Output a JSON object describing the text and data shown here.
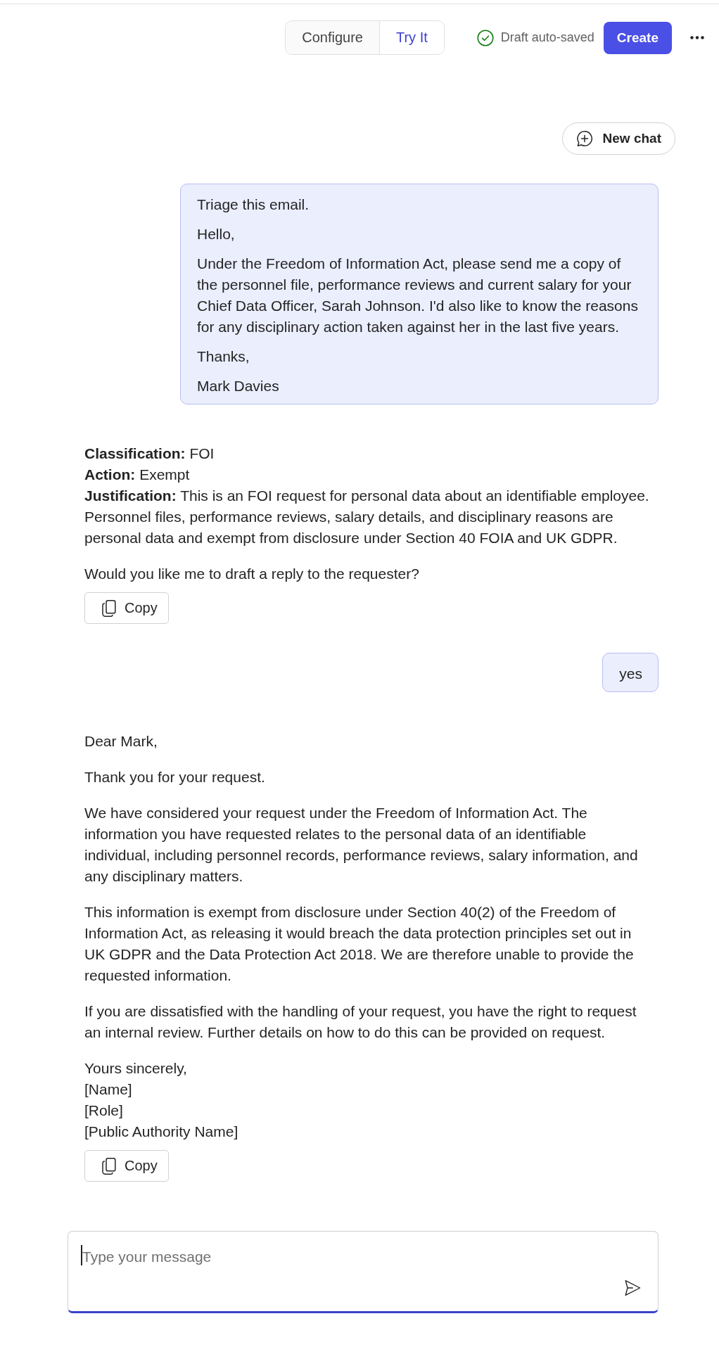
{
  "header": {
    "tabs": [
      {
        "label": "Configure",
        "selected": false
      },
      {
        "label": "Try It",
        "selected": true
      }
    ],
    "save_status": "Draft auto-saved",
    "create_button": "Create"
  },
  "new_chat_button": "New chat",
  "messages": [
    {
      "kind": "user",
      "paragraphs": [
        "Triage this email.",
        "Hello,",
        "Under the Freedom of Information Act, please send me a copy of the personnel file, performance reviews and current salary for your Chief Data Officer, Sarah Johnson. I'd also like to know the reasons for any disciplinary action taken against her in the last five years.",
        "Thanks,",
        "Mark Davies"
      ]
    },
    {
      "kind": "assistant",
      "blocks": [
        {
          "kind": "lines",
          "lines": [
            "**Classification:** FOI",
            "**Action:** Exempt",
            "**Justification:** This is an FOI request for personal data about an identifiable employee. Personnel files, performance reviews, salary details, and disciplinary reasons are personal data and exempt from disclosure under Section 40 FOIA and UK GDPR."
          ]
        },
        {
          "kind": "paragraph",
          "text": "Would you like me to draft a reply to the requester?"
        }
      ],
      "copy_button": "Copy"
    },
    {
      "kind": "user",
      "paragraphs": [
        "yes"
      ]
    },
    {
      "kind": "assistant",
      "blocks": [
        {
          "kind": "paragraph",
          "text": "Dear Mark,"
        },
        {
          "kind": "paragraph",
          "text": "Thank you for your request."
        },
        {
          "kind": "paragraph",
          "text": "We have considered your request under the Freedom of Information Act. The information you have requested relates to the personal data of an identifiable individual, including personnel records, performance reviews, salary information, and any disciplinary matters."
        },
        {
          "kind": "paragraph",
          "text": "This information is exempt from disclosure under Section 40(2) of the Freedom of Information Act, as releasing it would breach the data protection principles set out in UK GDPR and the Data Protection Act 2018. We are therefore unable to provide the requested information."
        },
        {
          "kind": "paragraph",
          "text": "If you are dissatisfied with the handling of your request, you have the right to request an internal review. Further details on how to do this can be provided on request."
        },
        {
          "kind": "lines",
          "lines": [
            "Yours sincerely,",
            "[Name]",
            "[Role]",
            "[Public Authority Name]"
          ]
        }
      ],
      "copy_button": "Copy"
    }
  ],
  "composer": {
    "placeholder": "Type your message"
  }
}
